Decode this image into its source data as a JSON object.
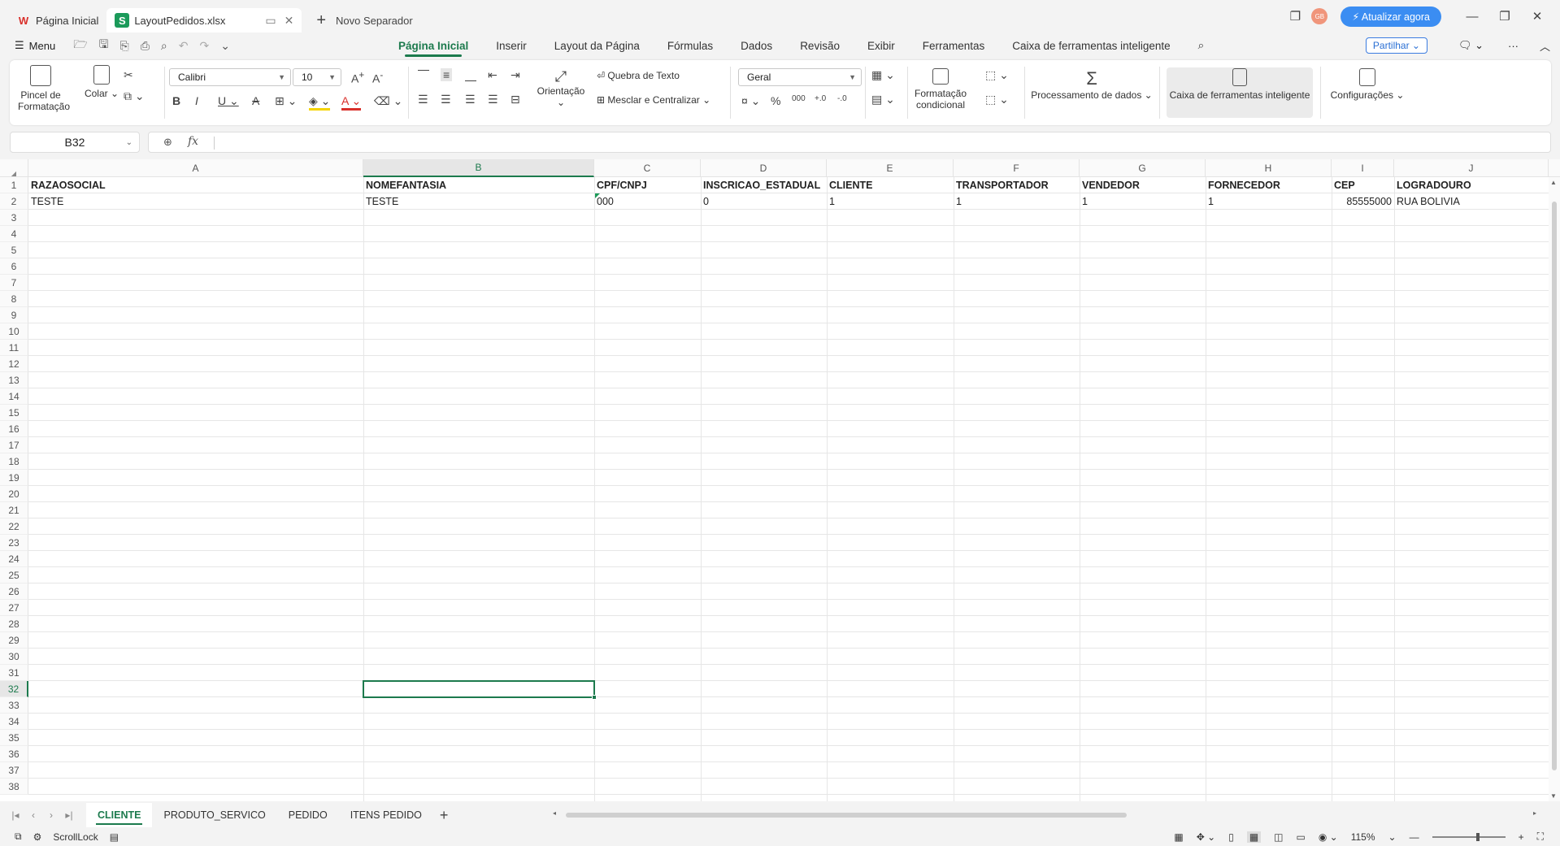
{
  "titlebar": {
    "home_tab": "Página Inicial",
    "file_tab": "LayoutPedidos.xlsx",
    "new_tab": "Novo Separador",
    "update_button": "Atualizar agora",
    "avatar_initials": "GB"
  },
  "menubar": {
    "menu_label": "Menu",
    "tabs": [
      "Página Inicial",
      "Inserir",
      "Layout da Página",
      "Fórmulas",
      "Dados",
      "Revisão",
      "Exibir",
      "Ferramentas",
      "Caixa de ferramentas inteligente"
    ],
    "share_label": "Partilhar"
  },
  "ribbon": {
    "format_painter": "Pincel de Formatação",
    "paste": "Colar",
    "font_name": "Calibri",
    "font_size": "10",
    "wrap_text": "Quebra de Texto",
    "merge_center": "Mesclar e Centralizar",
    "orientation": "Orientação",
    "number_format": "Geral",
    "conditional_format": "Formatação condicional",
    "data_processing": "Processamento de dados",
    "smart_toolbox": "Caixa de ferramentas inteligente",
    "settings": "Configurações"
  },
  "formula_bar": {
    "name_box": "B32",
    "fx_label": "fx",
    "formula": ""
  },
  "sheet": {
    "columns": [
      "A",
      "B",
      "C",
      "D",
      "E",
      "F",
      "G",
      "H",
      "I",
      "J"
    ],
    "selected_column": "B",
    "selected_row": "32",
    "rows": [
      "1",
      "2",
      "3",
      "4",
      "5",
      "6",
      "7",
      "8",
      "9",
      "10",
      "11",
      "12",
      "13",
      "14",
      "15",
      "16",
      "17",
      "18",
      "19",
      "20",
      "21",
      "22",
      "23",
      "24",
      "25",
      "26",
      "27",
      "28",
      "29",
      "30",
      "31",
      "32",
      "33",
      "34",
      "35",
      "36",
      "37",
      "38"
    ],
    "header_row": [
      "RAZAOSOCIAL",
      "NOMEFANTASIA",
      "CPF/CNPJ",
      "INSCRICAO_ESTADUAL",
      "CLIENTE",
      "TRANSPORTADOR",
      "VENDEDOR",
      "FORNECEDOR",
      "CEP",
      "LOGRADOURO"
    ],
    "data_row": [
      "TESTE",
      "TESTE",
      "000",
      "0",
      "1",
      "1",
      "1",
      "1",
      "85555000",
      "RUA BOLIVIA"
    ]
  },
  "sheet_tabs": [
    "CLIENTE",
    "PRODUTO_SERVICO",
    "PEDIDO",
    "ITENS PEDIDO"
  ],
  "active_sheet": "CLIENTE",
  "statusbar": {
    "scroll_lock": "ScrollLock",
    "zoom": "115%"
  },
  "colors": {
    "accent": "#1c7a4d",
    "update_button": "#3b8df2",
    "brand_red": "#d9302b"
  }
}
